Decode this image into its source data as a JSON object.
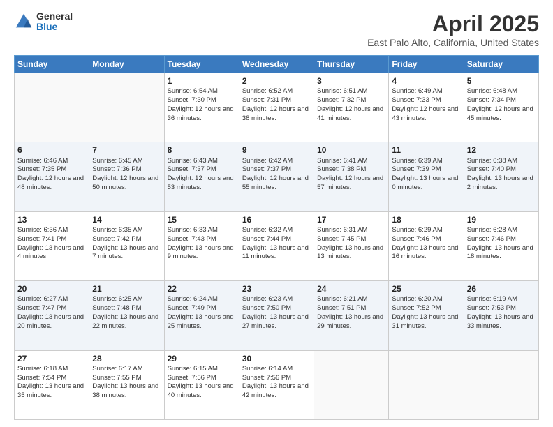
{
  "logo": {
    "general": "General",
    "blue": "Blue"
  },
  "header": {
    "title": "April 2025",
    "subtitle": "East Palo Alto, California, United States"
  },
  "days": [
    "Sunday",
    "Monday",
    "Tuesday",
    "Wednesday",
    "Thursday",
    "Friday",
    "Saturday"
  ],
  "weeks": [
    [
      {
        "num": "",
        "sunrise": "",
        "sunset": "",
        "daylight": "",
        "empty": true
      },
      {
        "num": "",
        "sunrise": "",
        "sunset": "",
        "daylight": "",
        "empty": true
      },
      {
        "num": "1",
        "sunrise": "Sunrise: 6:54 AM",
        "sunset": "Sunset: 7:30 PM",
        "daylight": "Daylight: 12 hours and 36 minutes."
      },
      {
        "num": "2",
        "sunrise": "Sunrise: 6:52 AM",
        "sunset": "Sunset: 7:31 PM",
        "daylight": "Daylight: 12 hours and 38 minutes."
      },
      {
        "num": "3",
        "sunrise": "Sunrise: 6:51 AM",
        "sunset": "Sunset: 7:32 PM",
        "daylight": "Daylight: 12 hours and 41 minutes."
      },
      {
        "num": "4",
        "sunrise": "Sunrise: 6:49 AM",
        "sunset": "Sunset: 7:33 PM",
        "daylight": "Daylight: 12 hours and 43 minutes."
      },
      {
        "num": "5",
        "sunrise": "Sunrise: 6:48 AM",
        "sunset": "Sunset: 7:34 PM",
        "daylight": "Daylight: 12 hours and 45 minutes."
      }
    ],
    [
      {
        "num": "6",
        "sunrise": "Sunrise: 6:46 AM",
        "sunset": "Sunset: 7:35 PM",
        "daylight": "Daylight: 12 hours and 48 minutes."
      },
      {
        "num": "7",
        "sunrise": "Sunrise: 6:45 AM",
        "sunset": "Sunset: 7:36 PM",
        "daylight": "Daylight: 12 hours and 50 minutes."
      },
      {
        "num": "8",
        "sunrise": "Sunrise: 6:43 AM",
        "sunset": "Sunset: 7:37 PM",
        "daylight": "Daylight: 12 hours and 53 minutes."
      },
      {
        "num": "9",
        "sunrise": "Sunrise: 6:42 AM",
        "sunset": "Sunset: 7:37 PM",
        "daylight": "Daylight: 12 hours and 55 minutes."
      },
      {
        "num": "10",
        "sunrise": "Sunrise: 6:41 AM",
        "sunset": "Sunset: 7:38 PM",
        "daylight": "Daylight: 12 hours and 57 minutes."
      },
      {
        "num": "11",
        "sunrise": "Sunrise: 6:39 AM",
        "sunset": "Sunset: 7:39 PM",
        "daylight": "Daylight: 13 hours and 0 minutes."
      },
      {
        "num": "12",
        "sunrise": "Sunrise: 6:38 AM",
        "sunset": "Sunset: 7:40 PM",
        "daylight": "Daylight: 13 hours and 2 minutes."
      }
    ],
    [
      {
        "num": "13",
        "sunrise": "Sunrise: 6:36 AM",
        "sunset": "Sunset: 7:41 PM",
        "daylight": "Daylight: 13 hours and 4 minutes."
      },
      {
        "num": "14",
        "sunrise": "Sunrise: 6:35 AM",
        "sunset": "Sunset: 7:42 PM",
        "daylight": "Daylight: 13 hours and 7 minutes."
      },
      {
        "num": "15",
        "sunrise": "Sunrise: 6:33 AM",
        "sunset": "Sunset: 7:43 PM",
        "daylight": "Daylight: 13 hours and 9 minutes."
      },
      {
        "num": "16",
        "sunrise": "Sunrise: 6:32 AM",
        "sunset": "Sunset: 7:44 PM",
        "daylight": "Daylight: 13 hours and 11 minutes."
      },
      {
        "num": "17",
        "sunrise": "Sunrise: 6:31 AM",
        "sunset": "Sunset: 7:45 PM",
        "daylight": "Daylight: 13 hours and 13 minutes."
      },
      {
        "num": "18",
        "sunrise": "Sunrise: 6:29 AM",
        "sunset": "Sunset: 7:46 PM",
        "daylight": "Daylight: 13 hours and 16 minutes."
      },
      {
        "num": "19",
        "sunrise": "Sunrise: 6:28 AM",
        "sunset": "Sunset: 7:46 PM",
        "daylight": "Daylight: 13 hours and 18 minutes."
      }
    ],
    [
      {
        "num": "20",
        "sunrise": "Sunrise: 6:27 AM",
        "sunset": "Sunset: 7:47 PM",
        "daylight": "Daylight: 13 hours and 20 minutes."
      },
      {
        "num": "21",
        "sunrise": "Sunrise: 6:25 AM",
        "sunset": "Sunset: 7:48 PM",
        "daylight": "Daylight: 13 hours and 22 minutes."
      },
      {
        "num": "22",
        "sunrise": "Sunrise: 6:24 AM",
        "sunset": "Sunset: 7:49 PM",
        "daylight": "Daylight: 13 hours and 25 minutes."
      },
      {
        "num": "23",
        "sunrise": "Sunrise: 6:23 AM",
        "sunset": "Sunset: 7:50 PM",
        "daylight": "Daylight: 13 hours and 27 minutes."
      },
      {
        "num": "24",
        "sunrise": "Sunrise: 6:21 AM",
        "sunset": "Sunset: 7:51 PM",
        "daylight": "Daylight: 13 hours and 29 minutes."
      },
      {
        "num": "25",
        "sunrise": "Sunrise: 6:20 AM",
        "sunset": "Sunset: 7:52 PM",
        "daylight": "Daylight: 13 hours and 31 minutes."
      },
      {
        "num": "26",
        "sunrise": "Sunrise: 6:19 AM",
        "sunset": "Sunset: 7:53 PM",
        "daylight": "Daylight: 13 hours and 33 minutes."
      }
    ],
    [
      {
        "num": "27",
        "sunrise": "Sunrise: 6:18 AM",
        "sunset": "Sunset: 7:54 PM",
        "daylight": "Daylight: 13 hours and 35 minutes."
      },
      {
        "num": "28",
        "sunrise": "Sunrise: 6:17 AM",
        "sunset": "Sunset: 7:55 PM",
        "daylight": "Daylight: 13 hours and 38 minutes."
      },
      {
        "num": "29",
        "sunrise": "Sunrise: 6:15 AM",
        "sunset": "Sunset: 7:56 PM",
        "daylight": "Daylight: 13 hours and 40 minutes."
      },
      {
        "num": "30",
        "sunrise": "Sunrise: 6:14 AM",
        "sunset": "Sunset: 7:56 PM",
        "daylight": "Daylight: 13 hours and 42 minutes."
      },
      {
        "num": "",
        "sunrise": "",
        "sunset": "",
        "daylight": "",
        "empty": true
      },
      {
        "num": "",
        "sunrise": "",
        "sunset": "",
        "daylight": "",
        "empty": true
      },
      {
        "num": "",
        "sunrise": "",
        "sunset": "",
        "daylight": "",
        "empty": true
      }
    ]
  ]
}
